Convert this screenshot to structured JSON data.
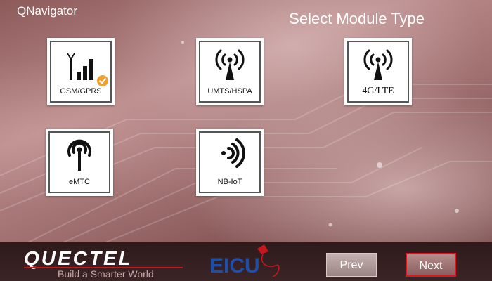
{
  "app": {
    "title": "QNavigator"
  },
  "header": {
    "title": "Select Module Type"
  },
  "modules": [
    {
      "label": "GSM/GPRS",
      "icon": "signal-bars-icon",
      "selected": true
    },
    {
      "label": "UMTS/HSPA",
      "icon": "radio-tower-icon",
      "selected": false
    },
    {
      "label": "4G/LTE",
      "icon": "radio-tower-icon",
      "selected": false
    },
    {
      "label": "eMTC",
      "icon": "antenna-icon",
      "selected": false
    },
    {
      "label": "NB-IoT",
      "icon": "nfc-waves-icon",
      "selected": false
    }
  ],
  "footer": {
    "brand": "QUECTEL",
    "tagline": "Build a Smarter World",
    "partner": "EICU",
    "prev_label": "Prev",
    "next_label": "Next"
  },
  "colors": {
    "next_border": "#e0141c",
    "badge": "#f0a030"
  }
}
